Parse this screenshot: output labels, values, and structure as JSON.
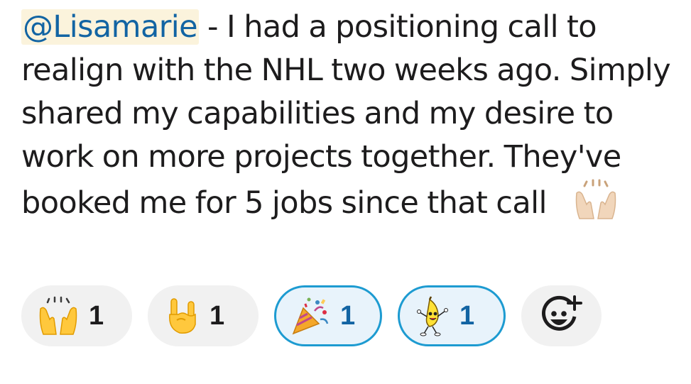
{
  "message": {
    "mention": "@Lisamarie",
    "text": " - I had a positioning call to realign with the NHL two weeks ago. Simply shared my capabilities and my desire to work on more projects together. They've booked me for 5 jobs since that call",
    "inline_emoji": "raised-hands-emoji"
  },
  "reactions": [
    {
      "emoji": "raised-hands-emoji",
      "count": "1",
      "active": false
    },
    {
      "emoji": "sign-of-horns-emoji",
      "count": "1",
      "active": false
    },
    {
      "emoji": "party-popper-emoji",
      "count": "1",
      "active": true
    },
    {
      "emoji": "dancing-banana-emoji",
      "count": "1",
      "active": true
    }
  ],
  "add_reaction": {
    "icon": "add-reaction-icon"
  },
  "colors": {
    "mention_bg": "#fbf3dc",
    "mention_text": "#1264a3",
    "active_border": "#1d9bd1",
    "active_bg": "#e8f3fb",
    "pill_bg": "#f1f1f1"
  }
}
